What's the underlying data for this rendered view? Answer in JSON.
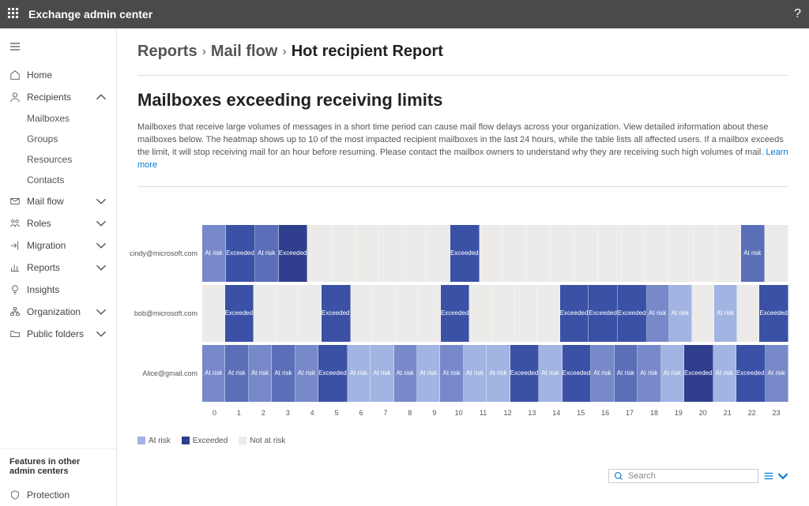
{
  "topbar": {
    "title": "Exchange admin center"
  },
  "sidebar": {
    "home": "Home",
    "recipients": {
      "label": "Recipients",
      "expanded": true,
      "items": [
        "Mailboxes",
        "Groups",
        "Resources",
        "Contacts"
      ]
    },
    "mailflow": "Mail flow",
    "roles": "Roles",
    "migration": "Migration",
    "reports": "Reports",
    "insights": "Insights",
    "organization": "Organization",
    "publicfolders": "Public folders",
    "features_header": "Features in other admin centers",
    "protection": "Protection"
  },
  "breadcrumb": {
    "a": "Reports",
    "b": "Mail flow",
    "c": "Hot recipient Report"
  },
  "page": {
    "heading": "Mailboxes exceeding receiving limits",
    "description": "Mailboxes that receive large volumes of messages in a short time period can cause mail flow delays across your organization. View detailed information about these mailboxes below. The heatmap shows up to 10 of the most impacted recipient mailboxes in the last 24 hours, while the table lists all affected users. If a mailbox exceeds the limit, it will stop receiving mail for an hour before resuming. Please contact the mailbox owners to understand why they are receiving such high volumes of mail. ",
    "learn_more": "Learn more"
  },
  "legend": {
    "atrisk": "At risk",
    "exceeded": "Exceeded",
    "notatrisk": "Not at risk"
  },
  "colors": {
    "notatrisk": "#edebe9",
    "atrisk_light": "#a2b4e2",
    "atrisk": "#7789c9",
    "atrisk_dark": "#5a6fb8",
    "exceeded": "#3b51a6",
    "exceeded_dark": "#2f3f8e"
  },
  "chart_data": {
    "type": "heatmap",
    "xlabel": "",
    "ylabel": "",
    "categories": [
      "0",
      "1",
      "2",
      "3",
      "4",
      "5",
      "6",
      "7",
      "8",
      "9",
      "10",
      "11",
      "12",
      "13",
      "14",
      "15",
      "16",
      "17",
      "18",
      "19",
      "20",
      "21",
      "22",
      "23"
    ],
    "rows": [
      {
        "name": "cindy@microsoft.com",
        "cells": [
          {
            "label": "At risk",
            "level": "atrisk"
          },
          {
            "label": "Exceeded",
            "level": "exceeded"
          },
          {
            "label": "At risk",
            "level": "atrisk_dark"
          },
          {
            "label": "Exceeded",
            "level": "exceeded_dark"
          },
          {
            "label": "",
            "level": "notatrisk"
          },
          {
            "label": "",
            "level": "notatrisk"
          },
          {
            "label": "",
            "level": "notatrisk"
          },
          {
            "label": "",
            "level": "notatrisk"
          },
          {
            "label": "",
            "level": "notatrisk"
          },
          {
            "label": "",
            "level": "notatrisk"
          },
          {
            "label": "Exceeded",
            "level": "exceeded"
          },
          {
            "label": "",
            "level": "notatrisk"
          },
          {
            "label": "",
            "level": "notatrisk"
          },
          {
            "label": "",
            "level": "notatrisk"
          },
          {
            "label": "",
            "level": "notatrisk"
          },
          {
            "label": "",
            "level": "notatrisk"
          },
          {
            "label": "",
            "level": "notatrisk"
          },
          {
            "label": "",
            "level": "notatrisk"
          },
          {
            "label": "",
            "level": "notatrisk"
          },
          {
            "label": "",
            "level": "notatrisk"
          },
          {
            "label": "",
            "level": "notatrisk"
          },
          {
            "label": "",
            "level": "notatrisk"
          },
          {
            "label": "At risk",
            "level": "atrisk_dark"
          },
          {
            "label": "",
            "level": "notatrisk"
          }
        ]
      },
      {
        "name": "bob@microsoft.com",
        "cells": [
          {
            "label": "",
            "level": "notatrisk"
          },
          {
            "label": "Exceeded",
            "level": "exceeded"
          },
          {
            "label": "",
            "level": "notatrisk"
          },
          {
            "label": "",
            "level": "notatrisk"
          },
          {
            "label": "",
            "level": "notatrisk"
          },
          {
            "label": "Exceeded",
            "level": "exceeded"
          },
          {
            "label": "",
            "level": "notatrisk"
          },
          {
            "label": "",
            "level": "notatrisk"
          },
          {
            "label": "",
            "level": "notatrisk"
          },
          {
            "label": "",
            "level": "notatrisk"
          },
          {
            "label": "Exceeded",
            "level": "exceeded"
          },
          {
            "label": "",
            "level": "notatrisk"
          },
          {
            "label": "",
            "level": "notatrisk"
          },
          {
            "label": "",
            "level": "notatrisk"
          },
          {
            "label": "",
            "level": "notatrisk"
          },
          {
            "label": "Exceeded",
            "level": "exceeded"
          },
          {
            "label": "Exceeded",
            "level": "exceeded"
          },
          {
            "label": "Exceeded",
            "level": "exceeded"
          },
          {
            "label": "At risk",
            "level": "atrisk"
          },
          {
            "label": "At risk",
            "level": "atrisk_light"
          },
          {
            "label": "",
            "level": "notatrisk"
          },
          {
            "label": "At risk",
            "level": "atrisk_light"
          },
          {
            "label": "",
            "level": "notatrisk"
          },
          {
            "label": "Exceeded",
            "level": "exceeded"
          }
        ]
      },
      {
        "name": "Alice@gmail.com",
        "cells": [
          {
            "label": "At risk",
            "level": "atrisk"
          },
          {
            "label": "At risk",
            "level": "atrisk_dark"
          },
          {
            "label": "At risk",
            "level": "atrisk"
          },
          {
            "label": "At risk",
            "level": "atrisk_dark"
          },
          {
            "label": "At risk",
            "level": "atrisk"
          },
          {
            "label": "Exceeded",
            "level": "exceeded"
          },
          {
            "label": "At risk",
            "level": "atrisk_light"
          },
          {
            "label": "At risk",
            "level": "atrisk_light"
          },
          {
            "label": "At risk",
            "level": "atrisk"
          },
          {
            "label": "At risk",
            "level": "atrisk_light"
          },
          {
            "label": "At risk",
            "level": "atrisk"
          },
          {
            "label": "At risk",
            "level": "atrisk_light"
          },
          {
            "label": "At risk",
            "level": "atrisk_light"
          },
          {
            "label": "Exceeded",
            "level": "exceeded"
          },
          {
            "label": "At risk",
            "level": "atrisk_light"
          },
          {
            "label": "Exceeded",
            "level": "exceeded"
          },
          {
            "label": "At risk",
            "level": "atrisk"
          },
          {
            "label": "At risk",
            "level": "atrisk_dark"
          },
          {
            "label": "At risk",
            "level": "atrisk"
          },
          {
            "label": "At risk",
            "level": "atrisk_light"
          },
          {
            "label": "Exceeded",
            "level": "exceeded_dark"
          },
          {
            "label": "At risk",
            "level": "atrisk_light"
          },
          {
            "label": "Exceeded",
            "level": "exceeded"
          },
          {
            "label": "At risk",
            "level": "atrisk"
          }
        ]
      }
    ]
  },
  "search": {
    "placeholder": "Search"
  }
}
